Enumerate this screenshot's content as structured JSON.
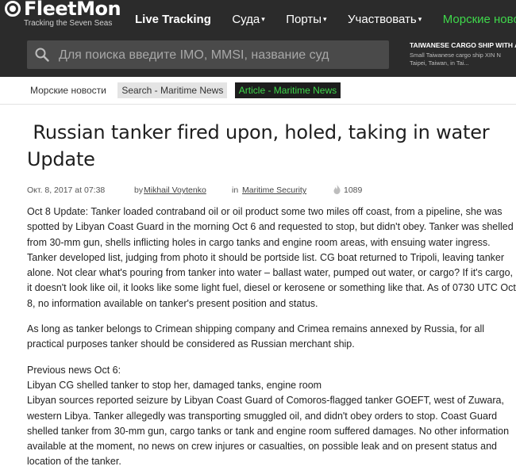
{
  "header": {
    "logo_text": "FleetMon",
    "logo_slogan": "Tracking the Seven Seas",
    "nav": [
      {
        "label": "Live Tracking",
        "dropdown": false
      },
      {
        "label": "Суда",
        "dropdown": true
      },
      {
        "label": "Порты",
        "dropdown": true
      },
      {
        "label": "Участвовать",
        "dropdown": true
      },
      {
        "label": "Морские новости",
        "dropdown": false
      }
    ],
    "caret": "▾",
    "search_placeholder": "Для поиска введите IMO, MMSI, название суд",
    "promo": {
      "title": "TAIWANESE CARGO SHIP WITH AL",
      "text_line1": "Small Taiwanese cargo ship XIN N",
      "text_line2": "Taipei, Taiwan, in Tai..."
    }
  },
  "breadcrumb": [
    "Морские новости",
    "Search - Maritime News",
    "Article - Maritime News"
  ],
  "article": {
    "title_line1": " Russian tanker fired upon, holed, taking in water",
    "title_line2": "Update",
    "date": "Окт. 8, 2017 at 07:38",
    "by_label": "by",
    "author": "Mikhail Voytenko",
    "in_label": "in",
    "category": "Maritime Security",
    "views": "1089",
    "paragraphs": [
      "Oct 8 Update: Tanker loaded contraband oil or oil product some two miles off coast, from a pipeline, she was spotted by Libyan Coast Guard in the morning Oct 6 and requested to stop, but didn't obey. Tanker was shelled from 30-mm gun, shells inflicting holes in cargo tanks and engine room areas, with ensuing water ingress. Tanker developed list, judging from photo it should be portside list. CG boat returned to Tripoli, leaving tanker alone. Not clear what's pouring from tanker into water – ballast water, pumped out water, or cargo? If it's cargo, it doesn't look like oil, it looks like some light fuel, diesel or kerosene or something like that. As of 0730 UTC Oct 8, no information available on tanker's present position and status.",
      "As long as tanker belongs to Crimean shipping company and Crimea remains annexed by Russia, for all practical purposes tanker should be considered as Russian merchant ship.",
      "Previous news Oct 6:",
      "Libyan CG shelled tanker to stop her, damaged tanks, engine room",
      "Libyan sources reported seizure by Libyan Coast Guard of Comoros-flagged tanker GOEFT, west of Zuwara, western Libya. Tanker allegedly was transporting smuggled oil, and didn't obey orders to stop. Coast Guard shelled tanker from 30-mm gun, cargo tanks or tank and engine room suffered damages. No other information available at the moment, no news on crew injures or casualties, on possible leak and on present status and location of the tanker."
    ]
  },
  "colors": {
    "header_bg": "#2b2b2b",
    "accent_green": "#3fd84b",
    "active_crumb_bg": "#1d1d1d"
  },
  "icons": [
    "fleetmon-logo-icon",
    "search-icon",
    "flame-icon",
    "chevron-down-icon"
  ]
}
